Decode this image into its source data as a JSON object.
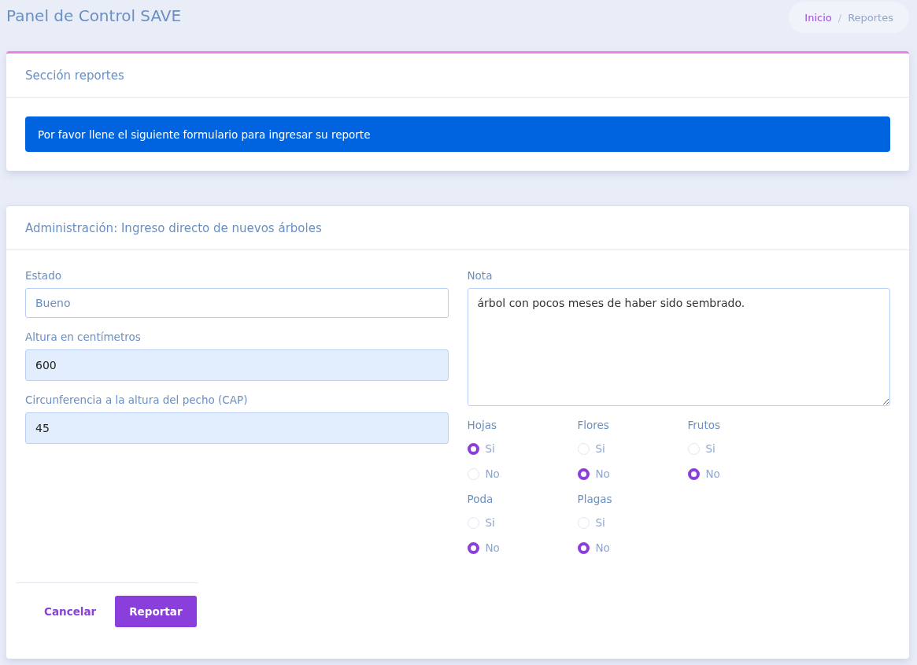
{
  "page_title": "Panel de Control SAVE",
  "breadcrumb_separator": "/",
  "breadcrumb": [
    {
      "label": "Inicio",
      "selected": false
    },
    {
      "label": "Reportes",
      "selected": true
    }
  ],
  "section_card": {
    "title": "Sección reportes",
    "alert": "Por favor llene el siguiente formulario para ingresar su reporte"
  },
  "form_card": {
    "title": "Administración: Ingreso directo de nuevos árboles",
    "fields": [
      {
        "label": "Estado",
        "value": "Bueno",
        "autofilled": false
      },
      {
        "label": "Altura en centímetros",
        "value": "600",
        "autofilled": true
      },
      {
        "label": "Circunferencia a la altura del pecho (CAP)",
        "value": "45",
        "autofilled": true
      }
    ],
    "note": {
      "label": "Nota",
      "value": "árbol con pocos meses de haber sido sembrado."
    },
    "radio_groups": [
      {
        "label": "Hojas",
        "options": [
          {
            "label": "Si",
            "selected": true
          },
          {
            "label": "No",
            "selected": false
          }
        ]
      },
      {
        "label": "Flores",
        "options": [
          {
            "label": "Si",
            "selected": false
          },
          {
            "label": "No",
            "selected": true
          }
        ]
      },
      {
        "label": "Frutos",
        "options": [
          {
            "label": "Si",
            "selected": false
          },
          {
            "label": "No",
            "selected": true
          }
        ]
      },
      {
        "label": "Poda",
        "options": [
          {
            "label": "Si",
            "selected": false
          },
          {
            "label": "No",
            "selected": true
          }
        ]
      },
      {
        "label": "Plagas",
        "options": [
          {
            "label": "Si",
            "selected": false
          },
          {
            "label": "No",
            "selected": true
          }
        ]
      }
    ],
    "buttons": [
      {
        "label": "Cancelar",
        "kind": "link"
      },
      {
        "label": "Reportar",
        "kind": "primary"
      }
    ]
  }
}
